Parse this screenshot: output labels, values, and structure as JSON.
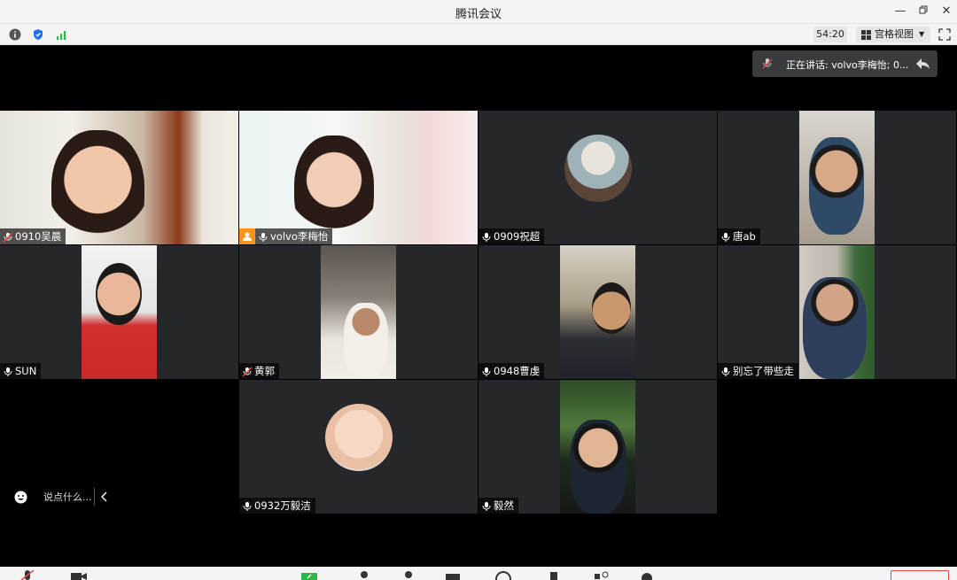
{
  "window": {
    "title": "腾讯会议"
  },
  "toolbar": {
    "timer": "54:20",
    "view_mode": "宫格视图"
  },
  "speaking": {
    "text": "正在讲话: volvo李梅怡; 0..."
  },
  "participants": [
    {
      "name": "0910吴晨",
      "muted": true
    },
    {
      "name": "volvo李梅怡",
      "muted": false
    },
    {
      "name": "0909祝超",
      "muted": false
    },
    {
      "name": "唐ab",
      "muted": false
    },
    {
      "name": "SUN",
      "muted": false
    },
    {
      "name": "黄郭",
      "muted": true
    },
    {
      "name": "0948曹虔",
      "muted": false
    },
    {
      "name": "别忘了带些走",
      "muted": false
    },
    {
      "name": "0932万毅洁",
      "muted": false
    },
    {
      "name": "毅然",
      "muted": false
    }
  ],
  "chat": {
    "placeholder": "说点什么..."
  },
  "colors": {
    "tile_bg": "#25272a",
    "active_border": "#2fbf71",
    "host_badge": "#f7931e"
  }
}
